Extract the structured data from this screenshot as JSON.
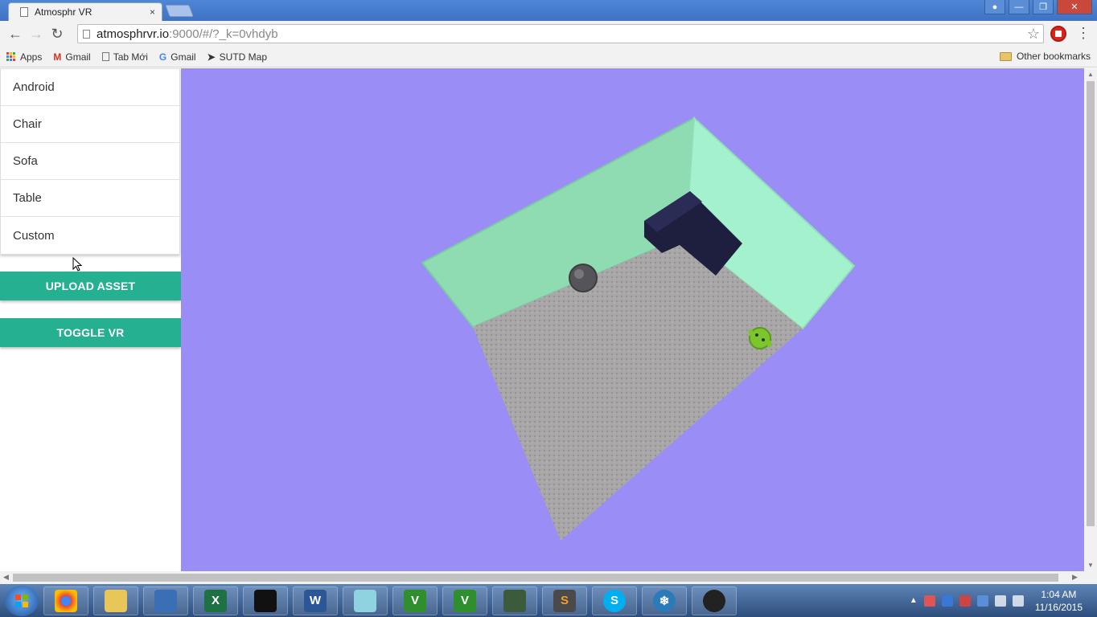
{
  "browser": {
    "tab_title": "Atmosphr VR",
    "tab_close": "×",
    "url_host": "atmosphrvr.io",
    "url_rest": ":9000/#/?_k=0vhdyb",
    "bookmarks": [
      {
        "label": "Apps",
        "icon": "apps-icon"
      },
      {
        "label": "Gmail",
        "icon": "gmail-icon"
      },
      {
        "label": "Tab Mới",
        "icon": "page-icon"
      },
      {
        "label": "Gmail",
        "icon": "google-icon"
      },
      {
        "label": "SUTD Map",
        "icon": "location-arrow-icon"
      }
    ],
    "other_bookmarks": "Other bookmarks"
  },
  "sidebar": {
    "assets": [
      "Android",
      "Chair",
      "Sofa",
      "Table",
      "Custom"
    ],
    "upload_label": "UPLOAD ASSET",
    "toggle_vr_label": "TOGGLE VR"
  },
  "scene": {
    "background_color": "#9a8df5",
    "wall_color": "#8fdcb3",
    "floor_color": "#a9a6a8",
    "sofa_color": "#1e1f3f"
  },
  "taskbar": {
    "apps": [
      "chrome-icon",
      "file-explorer-icon",
      "virtualbox-icon",
      "excel-icon",
      "cmd-icon",
      "word-icon",
      "notepad-icon",
      "vim-icon",
      "vim-icon",
      "terminal-icon",
      "sublime-icon",
      "skype-icon",
      "snowflake-icon",
      "obs-icon"
    ],
    "time": "1:04 AM",
    "date": "11/16/2015"
  },
  "colors": {
    "accent": "#26b092"
  }
}
